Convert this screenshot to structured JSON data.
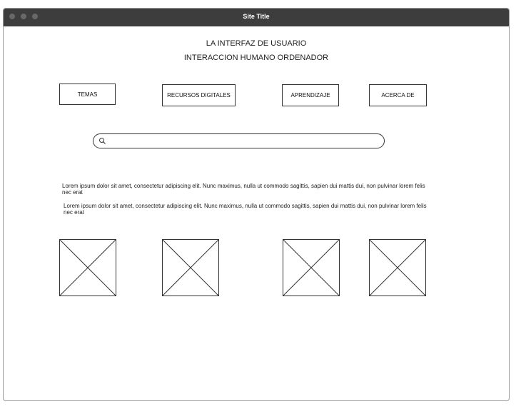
{
  "window": {
    "title": "Site Title"
  },
  "header": {
    "line1": "LA INTERFAZ DE USUARIO",
    "line2": "INTERACCION HUMANO ORDENADOR"
  },
  "nav": {
    "items": [
      {
        "label": "TEMAS"
      },
      {
        "label": "RECURSOS DIGITALES"
      },
      {
        "label": "APRENDIZAJE"
      },
      {
        "label": "ACERCA DE"
      }
    ]
  },
  "search": {
    "placeholder": "",
    "value": ""
  },
  "content": {
    "paragraphs": [
      "Lorem ipsum dolor sit amet, consectetur adipiscing elit. Nunc maximus, nulla ut commodo sagittis, sapien dui mattis dui, non pulvinar lorem felis nec erat",
      "Lorem ipsum dolor sit amet, consectetur adipiscing elit. Nunc maximus, nulla ut commodo sagittis, sapien dui mattis dui, non pulvinar lorem felis nec erat"
    ]
  },
  "images": {
    "count": 4,
    "icon": "image-placeholder-icon"
  },
  "colors": {
    "titlebar": "#3d3d3d",
    "border": "#333333"
  }
}
